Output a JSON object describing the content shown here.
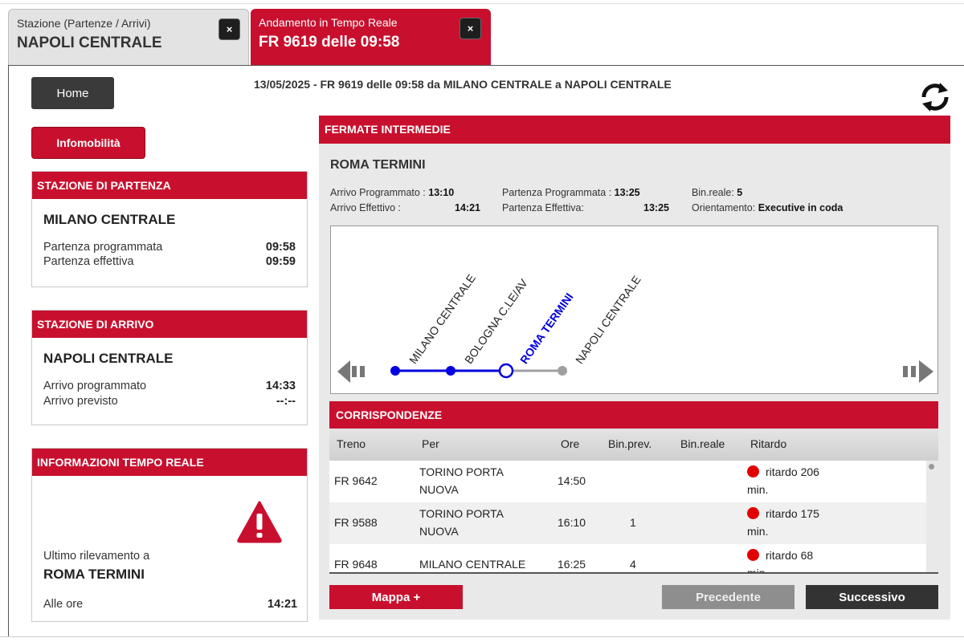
{
  "tabs": [
    {
      "line1": "Stazione (Partenze / Arrivi)",
      "line2": "NAPOLI CENTRALE",
      "close": "×"
    },
    {
      "line1": "Andamento in Tempo Reale",
      "line2": "FR 9619 delle 09:58",
      "close": "×"
    }
  ],
  "buttons": {
    "home": "Home",
    "infomobilita": "Infomobilità",
    "mappa": "Mappa +",
    "precedente": "Precedente",
    "successivo": "Successivo"
  },
  "headline": "13/05/2025 - FR 9619 delle 09:58 da MILANO CENTRALE a NAPOLI CENTRALE",
  "partenza": {
    "title": "STAZIONE DI PARTENZA",
    "station": "MILANO CENTRALE",
    "programmata_label": "Partenza programmata",
    "programmata": "09:58",
    "effettiva_label": "Partenza effettiva",
    "effettiva": "09:59"
  },
  "arrivo": {
    "title": "STAZIONE DI ARRIVO",
    "station": "NAPOLI CENTRALE",
    "programmato_label": "Arrivo programmato",
    "programmato": "14:33",
    "previsto_label": "Arrivo previsto",
    "previsto": "--:--"
  },
  "tempo_reale": {
    "title": "INFORMAZIONI TEMPO REALE",
    "rilevamento_label": "Ultimo rilevamento a",
    "station": "ROMA TERMINI",
    "ore_label": "Alle ore",
    "ore": "14:21"
  },
  "fermate": {
    "title": "FERMATE INTERMEDIE",
    "stop": "ROMA TERMINI",
    "arr_prog_label": "Arrivo Programmato :",
    "arr_prog": "13:10",
    "arr_eff_label": "Arrivo Effettivo :",
    "arr_eff": "14:21",
    "par_prog_label": "Partenza Programmata :",
    "par_prog": "13:25",
    "par_eff_label": "Partenza Effettiva:",
    "par_eff": "13:25",
    "bin_label": "Bin.reale:",
    "bin": "5",
    "orient_label": "Orientamento:",
    "orient": "Executive in coda",
    "route": [
      "MILANO CENTRALE",
      "BOLOGNA C.LE/AV",
      "ROMA TERMINI",
      "NAPOLI CENTRALE"
    ]
  },
  "corrispondenze": {
    "title": "CORRISPONDENZE",
    "headers": [
      "Treno",
      "Per",
      "Ore",
      "Bin.prev.",
      "Bin.reale",
      "Ritardo"
    ],
    "rows": [
      {
        "treno": "FR 9642",
        "per1": "TORINO PORTA",
        "per2": "NUOVA",
        "ore": "14:50",
        "binprev": "",
        "binreale": "",
        "rit1": "ritardo 206",
        "rit2": "min."
      },
      {
        "treno": "FR 9588",
        "per1": "TORINO PORTA",
        "per2": "NUOVA",
        "ore": "16:10",
        "binprev": "1",
        "binreale": "",
        "rit1": "ritardo 175",
        "rit2": "min."
      },
      {
        "treno": "FR 9648",
        "per1": "MILANO CENTRALE",
        "per2": "",
        "ore": "16:25",
        "binprev": "4",
        "binreale": "",
        "rit1": "ritardo 68",
        "rit2": "min."
      }
    ]
  },
  "colors": {
    "accent": "#c8102e",
    "route_done": "#0000e0",
    "route_todo": "#a0a0a0",
    "delay": "#e10000"
  }
}
